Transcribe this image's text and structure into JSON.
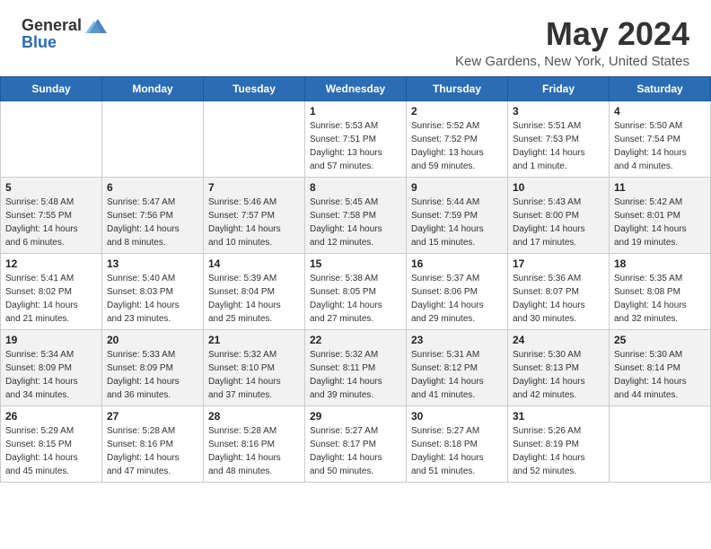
{
  "header": {
    "logo_general": "General",
    "logo_blue": "Blue",
    "title": "May 2024",
    "location": "Kew Gardens, New York, United States"
  },
  "days_of_week": [
    "Sunday",
    "Monday",
    "Tuesday",
    "Wednesday",
    "Thursday",
    "Friday",
    "Saturday"
  ],
  "weeks": [
    {
      "days": [
        {
          "number": "",
          "info": ""
        },
        {
          "number": "",
          "info": ""
        },
        {
          "number": "",
          "info": ""
        },
        {
          "number": "1",
          "info": "Sunrise: 5:53 AM\nSunset: 7:51 PM\nDaylight: 13 hours\nand 57 minutes."
        },
        {
          "number": "2",
          "info": "Sunrise: 5:52 AM\nSunset: 7:52 PM\nDaylight: 13 hours\nand 59 minutes."
        },
        {
          "number": "3",
          "info": "Sunrise: 5:51 AM\nSunset: 7:53 PM\nDaylight: 14 hours\nand 1 minute."
        },
        {
          "number": "4",
          "info": "Sunrise: 5:50 AM\nSunset: 7:54 PM\nDaylight: 14 hours\nand 4 minutes."
        }
      ]
    },
    {
      "days": [
        {
          "number": "5",
          "info": "Sunrise: 5:48 AM\nSunset: 7:55 PM\nDaylight: 14 hours\nand 6 minutes."
        },
        {
          "number": "6",
          "info": "Sunrise: 5:47 AM\nSunset: 7:56 PM\nDaylight: 14 hours\nand 8 minutes."
        },
        {
          "number": "7",
          "info": "Sunrise: 5:46 AM\nSunset: 7:57 PM\nDaylight: 14 hours\nand 10 minutes."
        },
        {
          "number": "8",
          "info": "Sunrise: 5:45 AM\nSunset: 7:58 PM\nDaylight: 14 hours\nand 12 minutes."
        },
        {
          "number": "9",
          "info": "Sunrise: 5:44 AM\nSunset: 7:59 PM\nDaylight: 14 hours\nand 15 minutes."
        },
        {
          "number": "10",
          "info": "Sunrise: 5:43 AM\nSunset: 8:00 PM\nDaylight: 14 hours\nand 17 minutes."
        },
        {
          "number": "11",
          "info": "Sunrise: 5:42 AM\nSunset: 8:01 PM\nDaylight: 14 hours\nand 19 minutes."
        }
      ]
    },
    {
      "days": [
        {
          "number": "12",
          "info": "Sunrise: 5:41 AM\nSunset: 8:02 PM\nDaylight: 14 hours\nand 21 minutes."
        },
        {
          "number": "13",
          "info": "Sunrise: 5:40 AM\nSunset: 8:03 PM\nDaylight: 14 hours\nand 23 minutes."
        },
        {
          "number": "14",
          "info": "Sunrise: 5:39 AM\nSunset: 8:04 PM\nDaylight: 14 hours\nand 25 minutes."
        },
        {
          "number": "15",
          "info": "Sunrise: 5:38 AM\nSunset: 8:05 PM\nDaylight: 14 hours\nand 27 minutes."
        },
        {
          "number": "16",
          "info": "Sunrise: 5:37 AM\nSunset: 8:06 PM\nDaylight: 14 hours\nand 29 minutes."
        },
        {
          "number": "17",
          "info": "Sunrise: 5:36 AM\nSunset: 8:07 PM\nDaylight: 14 hours\nand 30 minutes."
        },
        {
          "number": "18",
          "info": "Sunrise: 5:35 AM\nSunset: 8:08 PM\nDaylight: 14 hours\nand 32 minutes."
        }
      ]
    },
    {
      "days": [
        {
          "number": "19",
          "info": "Sunrise: 5:34 AM\nSunset: 8:09 PM\nDaylight: 14 hours\nand 34 minutes."
        },
        {
          "number": "20",
          "info": "Sunrise: 5:33 AM\nSunset: 8:09 PM\nDaylight: 14 hours\nand 36 minutes."
        },
        {
          "number": "21",
          "info": "Sunrise: 5:32 AM\nSunset: 8:10 PM\nDaylight: 14 hours\nand 37 minutes."
        },
        {
          "number": "22",
          "info": "Sunrise: 5:32 AM\nSunset: 8:11 PM\nDaylight: 14 hours\nand 39 minutes."
        },
        {
          "number": "23",
          "info": "Sunrise: 5:31 AM\nSunset: 8:12 PM\nDaylight: 14 hours\nand 41 minutes."
        },
        {
          "number": "24",
          "info": "Sunrise: 5:30 AM\nSunset: 8:13 PM\nDaylight: 14 hours\nand 42 minutes."
        },
        {
          "number": "25",
          "info": "Sunrise: 5:30 AM\nSunset: 8:14 PM\nDaylight: 14 hours\nand 44 minutes."
        }
      ]
    },
    {
      "days": [
        {
          "number": "26",
          "info": "Sunrise: 5:29 AM\nSunset: 8:15 PM\nDaylight: 14 hours\nand 45 minutes."
        },
        {
          "number": "27",
          "info": "Sunrise: 5:28 AM\nSunset: 8:16 PM\nDaylight: 14 hours\nand 47 minutes."
        },
        {
          "number": "28",
          "info": "Sunrise: 5:28 AM\nSunset: 8:16 PM\nDaylight: 14 hours\nand 48 minutes."
        },
        {
          "number": "29",
          "info": "Sunrise: 5:27 AM\nSunset: 8:17 PM\nDaylight: 14 hours\nand 50 minutes."
        },
        {
          "number": "30",
          "info": "Sunrise: 5:27 AM\nSunset: 8:18 PM\nDaylight: 14 hours\nand 51 minutes."
        },
        {
          "number": "31",
          "info": "Sunrise: 5:26 AM\nSunset: 8:19 PM\nDaylight: 14 hours\nand 52 minutes."
        },
        {
          "number": "",
          "info": ""
        }
      ]
    }
  ]
}
